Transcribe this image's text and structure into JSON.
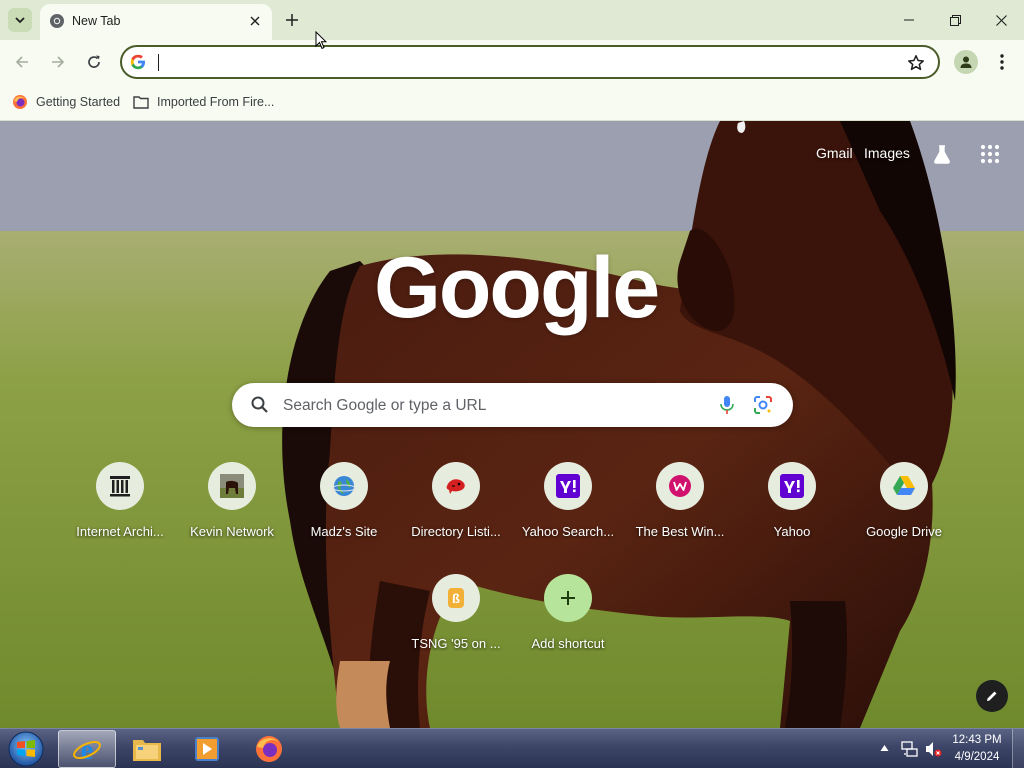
{
  "browser": {
    "tab": {
      "title": "New Tab"
    },
    "omnibox": {
      "value": "",
      "placeholder": ""
    },
    "bookmarks": [
      {
        "label": "Getting Started",
        "icon": "firefox-icon"
      },
      {
        "label": "Imported From Fire...",
        "icon": "folder-icon"
      }
    ]
  },
  "ntp": {
    "top_links": {
      "gmail": "Gmail",
      "images": "Images"
    },
    "logo": "Google",
    "search": {
      "placeholder": "Search Google or type a URL"
    },
    "shortcuts": [
      {
        "label": "Internet Archi...",
        "icon": "archive-icon"
      },
      {
        "label": "Kevin Network",
        "icon": "horse-thumbnail-icon"
      },
      {
        "label": "Madz's Site",
        "icon": "globe-icon"
      },
      {
        "label": "Directory Listi...",
        "icon": "red-creature-icon"
      },
      {
        "label": "Yahoo Search...",
        "icon": "yahoo-icon"
      },
      {
        "label": "The Best Win...",
        "icon": "w-badge-icon"
      },
      {
        "label": "Yahoo",
        "icon": "yahoo-icon"
      },
      {
        "label": "Google Drive",
        "icon": "google-drive-icon"
      },
      {
        "label": "TSNG '95 on ...",
        "icon": "tsng-icon"
      },
      {
        "label": "Add shortcut",
        "icon": "plus-icon"
      }
    ]
  },
  "taskbar": {
    "clock": {
      "time": "12:43 PM",
      "date": "4/9/2024"
    },
    "items": [
      "internet-explorer-icon",
      "file-explorer-icon",
      "media-player-icon",
      "firefox-icon"
    ]
  },
  "colors": {
    "chrome_bg": "#dfe9d4",
    "toolbar_bg": "#f7fbf1",
    "omnibox_border": "#4a5c2a",
    "yahoo_purple": "#6001d2",
    "add_shortcut_green": "#b6e49a"
  }
}
